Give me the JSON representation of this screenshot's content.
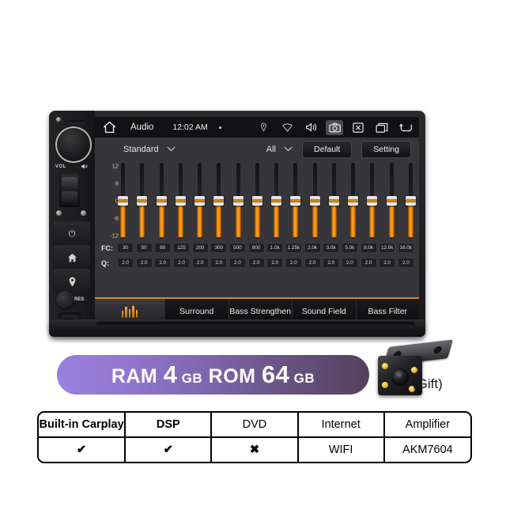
{
  "radio": {
    "left_panel": {
      "vol_label": "VOL",
      "mute_icon": "mute-speaker-icon",
      "res_label": "RES",
      "buttons": [
        {
          "name": "power",
          "glyph": "⏻"
        },
        {
          "name": "home",
          "glyph": "⌂"
        },
        {
          "name": "navigation",
          "glyph": "◉"
        }
      ]
    },
    "status_bar": {
      "home_icon": "home-icon",
      "title": "Audio",
      "clock": "12:02 AM",
      "system_icons": [
        {
          "name": "location-pin-icon",
          "glyph": "◎"
        },
        {
          "name": "wifi-icon",
          "glyph": "▽"
        },
        {
          "name": "volume-icon",
          "glyph": "ὐA"
        },
        {
          "name": "camera-icon",
          "glyph": "▣",
          "highlighted": true
        },
        {
          "name": "close-box-icon",
          "glyph": "⌧"
        },
        {
          "name": "recents-icon",
          "glyph": "❐"
        },
        {
          "name": "back-icon",
          "glyph": "↩"
        }
      ]
    },
    "controls": {
      "preset_label": "Standard",
      "channel_label": "All",
      "default_label": "Default",
      "setting_label": "Setting",
      "chevron": "⌄"
    },
    "equalizer": {
      "scale_labels": [
        "12",
        "6",
        "0",
        "-6",
        "-12"
      ],
      "fc_row_label": "FC:",
      "q_row_label": "Q:",
      "bands": [
        {
          "fc": "30",
          "q": "2.0",
          "gain": 0
        },
        {
          "fc": "50",
          "q": "2.0",
          "gain": 0
        },
        {
          "fc": "80",
          "q": "2.0",
          "gain": 0
        },
        {
          "fc": "125",
          "q": "2.0",
          "gain": 0
        },
        {
          "fc": "200",
          "q": "2.0",
          "gain": 0
        },
        {
          "fc": "300",
          "q": "2.0",
          "gain": 0
        },
        {
          "fc": "500",
          "q": "2.0",
          "gain": 0
        },
        {
          "fc": "800",
          "q": "2.0",
          "gain": 0
        },
        {
          "fc": "1.0k",
          "q": "2.0",
          "gain": 0
        },
        {
          "fc": "1.25k",
          "q": "2.0",
          "gain": 0
        },
        {
          "fc": "2.0k",
          "q": "2.0",
          "gain": 0
        },
        {
          "fc": "3.0k",
          "q": "2.0",
          "gain": 0
        },
        {
          "fc": "5.0k",
          "q": "2.0",
          "gain": 0
        },
        {
          "fc": "8.0k",
          "q": "2.0",
          "gain": 0
        },
        {
          "fc": "12.0k",
          "q": "2.0",
          "gain": 0
        },
        {
          "fc": "16.0k",
          "q": "2.0",
          "gain": 0
        }
      ]
    },
    "tabs": [
      {
        "label": "",
        "icon": "equalizer-icon",
        "active": true
      },
      {
        "label": "Surround",
        "active": false
      },
      {
        "label": "Bass Strengthen",
        "active": false
      },
      {
        "label": "Sound Field",
        "active": false
      },
      {
        "label": "Bass Filter",
        "active": false
      }
    ]
  },
  "banner": {
    "ram_label": "RAM",
    "ram_value": "4",
    "ram_unit": "GB",
    "rom_label": "ROM",
    "rom_value": "64",
    "rom_unit": "GB",
    "gradient_start": "#9b7fe0",
    "gradient_end": "#55415c"
  },
  "camera": {
    "gift_label": "(Gift)",
    "led_count": 4,
    "led_color": "#e0b41e"
  },
  "feature_table": {
    "headers": [
      "Built-in Carplay",
      "DSP",
      "DVD",
      "Internet",
      "Amplifier"
    ],
    "header_bold": [
      true,
      true,
      false,
      false,
      false
    ],
    "values": [
      "✔",
      "✔",
      "✖",
      "WIFI",
      "AKM7604"
    ],
    "value_is_mark": [
      true,
      true,
      true,
      false,
      false
    ]
  }
}
